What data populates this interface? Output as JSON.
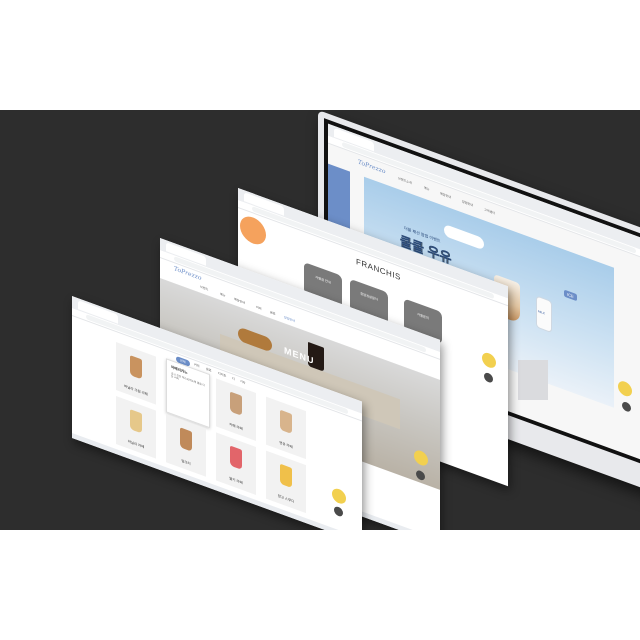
{
  "brand": {
    "logo_text": "ToPrezzo"
  },
  "browser": {
    "tab_title": "ToPrezzo"
  },
  "monitor": {
    "nav": [
      "브랜드소개",
      "메뉴",
      "매장안내",
      "창업안내",
      "고객센터"
    ],
    "hero": {
      "line1": "더블 패션 팝업 이벤트",
      "title": "쿨쿨 우유",
      "badge": "ICE"
    },
    "milk_label": "MILK"
  },
  "franchise": {
    "heading": "FRANCHIS",
    "cards": [
      "가맹점 안내",
      "창업개설절차",
      "가맹문의"
    ]
  },
  "menu_page": {
    "nav": [
      "브랜드",
      "메뉴",
      "매장안내",
      "커피",
      "음료",
      "창업안내"
    ],
    "banner_title": "MENU"
  },
  "menu_list": {
    "filters": [
      "전체",
      "커피",
      "음료",
      "디저트",
      "티",
      "기타"
    ],
    "products": [
      {
        "name": "바닐라 크림 라떼",
        "color": "#c9935f"
      },
      {
        "name": "아메리카노",
        "color": "#3c2a21"
      },
      {
        "name": "카페 라떼",
        "color": "#c8a07a"
      },
      {
        "name": "연유 라떼",
        "color": "#d8b48c"
      },
      {
        "name": "바닐라 라떼",
        "color": "#e6c88a"
      },
      {
        "name": "밀크티",
        "color": "#c08a5a"
      },
      {
        "name": "딸기 라떼",
        "color": "#e2656a"
      },
      {
        "name": "망고 스무디",
        "color": "#f0c04a"
      }
    ],
    "popup": {
      "title": "아메리카노",
      "desc": "깊고 진한 에스프레소에 물을 더한 커피"
    }
  },
  "colors": {
    "stage": "#2d2d2d",
    "accent_blue": "#6c8ec8",
    "accent_yellow": "#f2d04f",
    "accent_orange": "#f5a25d"
  }
}
